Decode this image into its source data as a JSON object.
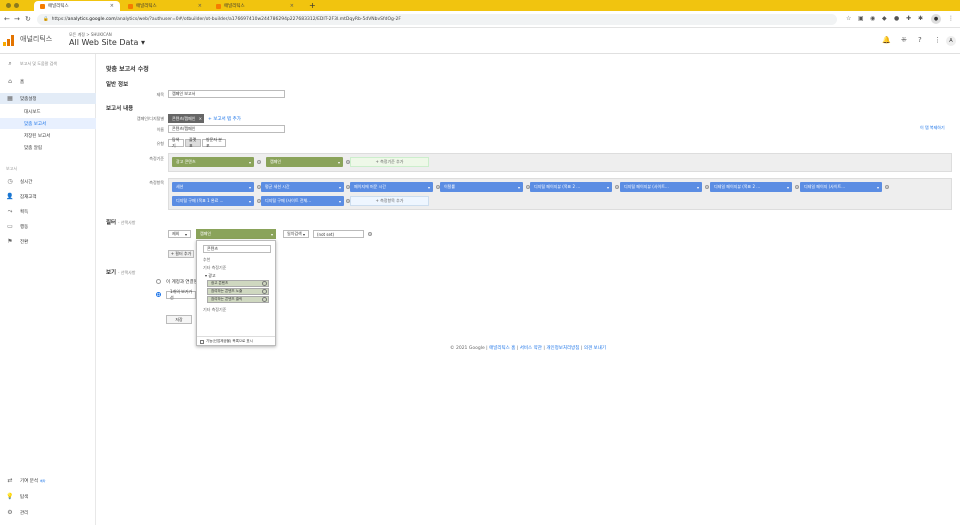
{
  "browser": {
    "tabs": [
      {
        "label": "애널리틱스"
      },
      {
        "label": "애널리틱스"
      },
      {
        "label": "애널리틱스"
      }
    ],
    "new_tab": "+",
    "url_scheme": "https://",
    "url_host": "analytics.google.com",
    "url_path": "/analytics/web/?authuser=0#/otbuilder/ot-builder/a176697410w244786294p227683312/EDIT-2F3I.mtDqyRb-5dVNbvSfdOg-2F"
  },
  "header": {
    "brand": "애널리틱스",
    "breadcrumb": "모든 계정 > SHUKICAN",
    "view_name": "All Web Site Data",
    "view_caret": "▾"
  },
  "sidebar": {
    "search_placeholder": "보고서 및 도움말 검색",
    "items": [
      {
        "label": "홈"
      },
      {
        "label": "맞춤설정"
      },
      {
        "label": "대시보드"
      },
      {
        "label": "맞춤 보고서"
      },
      {
        "label": "저장된 보고서"
      },
      {
        "label": "맞춤 알림"
      }
    ],
    "section_label": "보고서",
    "reports": [
      {
        "label": "실시간"
      },
      {
        "label": "잠재고객"
      },
      {
        "label": "획득"
      },
      {
        "label": "행동"
      },
      {
        "label": "전환"
      }
    ],
    "bottom": [
      {
        "label": "기여 분석",
        "badge": "베타"
      },
      {
        "label": "탐색"
      },
      {
        "label": "관리"
      }
    ]
  },
  "main": {
    "page_title": "맞춤 보고서 수정",
    "general_title": "일반 정보",
    "title_label": "제목",
    "title_value": "캠페인 보고서",
    "content_title": "보고서 내용",
    "report_tab_label": "캠페인/디지털별",
    "report_tab_chip": "콘텐츠/캠페인",
    "add_tab_link": "+ 보고서 탭 추가",
    "copy_tab_link": "이 탭 복제하기",
    "name_label": "이름",
    "name_value": "콘텐츠/캠페인",
    "type_label": "유형",
    "types": [
      "탐색기",
      "플랫 표",
      "방문자 분포"
    ],
    "metric_groups_label": "측정기준",
    "dimension_chips": [
      "광고 콘텐츠",
      "캠페인"
    ],
    "add_dimension": "+ 측정기준 추가",
    "metrics_label": "측정항목",
    "metric_chips": [
      "세션",
      "평균 세션 시간",
      "페이지에 머문 시간",
      "이탈률",
      "디지털 페이지뷰 (목표 2 ...",
      "디지털 페이지뷰 (사이트...",
      "디테일 페이지뷰 (목표 2 ...",
      "디테일 페이지 (사이트..."
    ],
    "metric_chips_row2": [
      "디지털 구매 (목표 1 완료 ...",
      "디지털 구매 (사이트 전체..."
    ],
    "add_metric": "+ 측정항목 추가",
    "filter_title": "필터",
    "filter_optional": "- 선택사항",
    "filter_include": "제외",
    "filter_dimension": "캠페인",
    "filter_match": "일치검색",
    "filter_value": "(not set)",
    "filter_and": "and",
    "filter_add": "+ 필터 추가",
    "views_title": "보기",
    "views_optional": "- 선택사항",
    "view_option1": "이 계정과 연결된",
    "view_option2": "1개의 보기가 선",
    "save_button": "저장",
    "dropdown": {
      "search_value": "콘텐츠",
      "items": [
        "추천",
        "기타 측정기준",
        "▾ 광고"
      ],
      "options": [
        "광고 콘텐츠",
        "참여하는 콘텐츠 노출",
        "참여하는 콘텐츠 클릭"
      ],
      "other": "기타 측정기준",
      "footer": "기능(신업제공물) 목록으로 표시"
    }
  },
  "footer": {
    "copyright": "© 2021 Google",
    "links": [
      "애널리틱스 홈",
      "서비스 약관",
      "개인정보처리방침",
      "의견 보내기"
    ],
    "sep": " | "
  }
}
